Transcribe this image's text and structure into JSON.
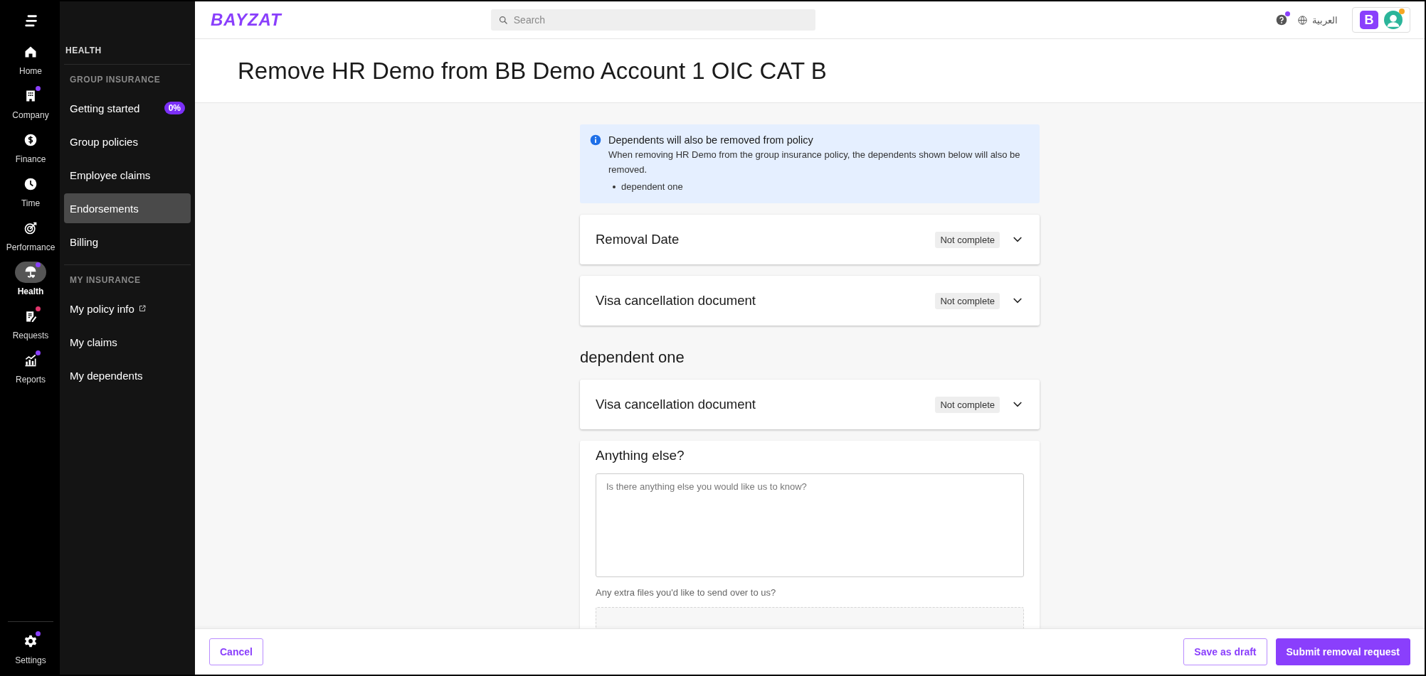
{
  "rail": {
    "items": [
      {
        "label": "Home",
        "selected": false
      },
      {
        "label": "Company",
        "selected": false,
        "color": "#8a3ffc"
      },
      {
        "label": "Finance",
        "selected": false
      },
      {
        "label": "Time",
        "selected": false
      },
      {
        "label": "Performance",
        "selected": false
      },
      {
        "label": "Health",
        "selected": true,
        "color": "#8a3ffc"
      },
      {
        "label": "Requests",
        "selected": false,
        "color": "#e0356b"
      },
      {
        "label": "Reports",
        "selected": false,
        "color": "#8a3ffc"
      }
    ],
    "settings": {
      "label": "Settings",
      "selected": false,
      "color": "#8a3ffc"
    }
  },
  "sidebar": {
    "title": "HEALTH",
    "groups": [
      {
        "heading": "GROUP INSURANCE",
        "items": [
          {
            "label": "Getting started",
            "selected": false,
            "badge": "0%"
          },
          {
            "label": "Group policies",
            "selected": false
          },
          {
            "label": "Employee claims",
            "selected": false
          },
          {
            "label": "Endorsements",
            "selected": true
          },
          {
            "label": "Billing",
            "selected": false
          }
        ]
      },
      {
        "heading": "MY INSURANCE",
        "items": [
          {
            "label": "My policy info",
            "selected": false,
            "external": true
          },
          {
            "label": "My claims",
            "selected": false
          },
          {
            "label": "My dependents",
            "selected": false
          }
        ]
      }
    ]
  },
  "topbar": {
    "logo": "BAYZAT",
    "search": {
      "placeholder": "Search"
    },
    "help": {
      "color": "#8a3ffc"
    },
    "language": "العربية",
    "account": {
      "initial": "B",
      "color": "#f5a623"
    }
  },
  "title": "Remove HR Demo from BB Demo Account 1 OIC CAT B",
  "alert": {
    "title": "Dependents will also be removed from policy",
    "body": "When removing HR Demo from the group insurance policy, the dependents shown below will also be removed.",
    "items": [
      "dependent one"
    ]
  },
  "sections": [
    {
      "kind": "card",
      "title": "Removal Date",
      "status": "Not complete",
      "expanded": false
    },
    {
      "kind": "card",
      "title": "Visa cancellation document",
      "status": "Not complete",
      "expanded": false
    },
    {
      "kind": "heading",
      "title": "dependent one"
    },
    {
      "kind": "card",
      "title": "Visa cancellation document",
      "status": "Not complete",
      "expanded": false
    }
  ],
  "extra": {
    "title": "Anything else?",
    "placeholder": "Is there anything else you would like us to know?",
    "files_label": "Any extra files you'd like to send over to us?"
  },
  "footer": {
    "buttons": [
      {
        "label": "Cancel",
        "kind": "secondary"
      },
      {
        "label": "Save as draft",
        "kind": "secondary"
      },
      {
        "label": "Submit removal request",
        "kind": "primary"
      }
    ]
  }
}
